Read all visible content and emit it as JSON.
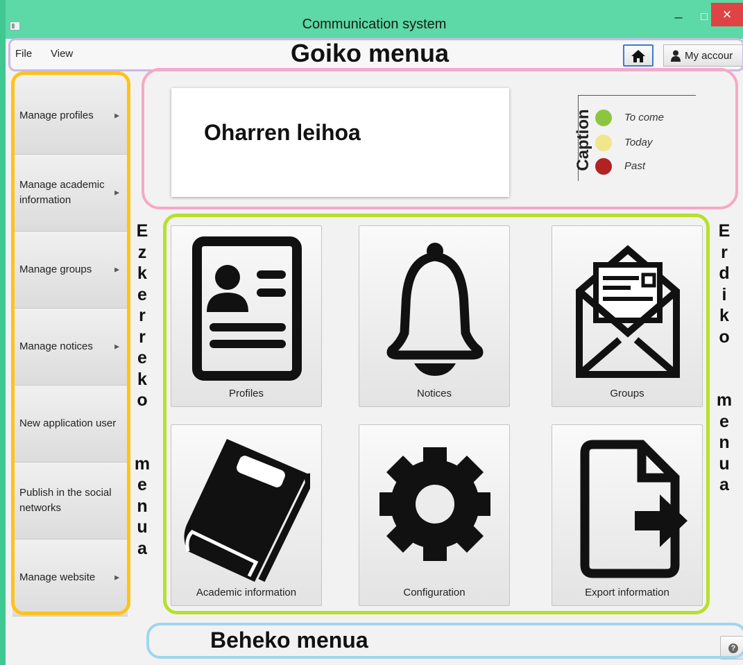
{
  "window": {
    "title": "Communication system",
    "minimize_glyph": "–",
    "maximize_glyph": "□",
    "close_glyph": "×"
  },
  "top_menu": {
    "items": [
      "File",
      "View"
    ],
    "annotation": "Goiko menua",
    "account_label": "My accour"
  },
  "left_menu": {
    "items": [
      {
        "label": "Manage profiles",
        "has_submenu": true
      },
      {
        "label": "Manage academic information",
        "has_submenu": true
      },
      {
        "label": "Manage groups",
        "has_submenu": true
      },
      {
        "label": "Manage notices",
        "has_submenu": true
      },
      {
        "label": "New application user",
        "has_submenu": false
      },
      {
        "label": "Publish in the social networks",
        "has_submenu": false
      },
      {
        "label": "Manage website",
        "has_submenu": true
      }
    ],
    "submenu_arrow": "▶",
    "annotation": "Ezkerreko menua"
  },
  "notes": {
    "annotation": "Oharren leihoa",
    "caption_title": "Caption",
    "legend": [
      {
        "label": "To come",
        "color": "#8cc63f"
      },
      {
        "label": "Today",
        "color": "#f0e68c"
      },
      {
        "label": "Past",
        "color": "#b22222"
      }
    ]
  },
  "center": {
    "annotation": "Erdiko menua",
    "tiles": [
      {
        "label": "Profiles",
        "icon": "profile-card-icon"
      },
      {
        "label": "Notices",
        "icon": "bell-icon"
      },
      {
        "label": "Groups",
        "icon": "envelope-letter-icon"
      },
      {
        "label": "Academic information",
        "icon": "book-icon"
      },
      {
        "label": "Configuration",
        "icon": "gear-icon"
      },
      {
        "label": "Export information",
        "icon": "file-export-icon"
      }
    ]
  },
  "bottom": {
    "annotation": "Beheko menua",
    "help_glyph": "?"
  },
  "colors": {
    "accent_frame": "#3fc891",
    "close_button": "#e04343",
    "home_button_border": "#3a7bd5"
  }
}
